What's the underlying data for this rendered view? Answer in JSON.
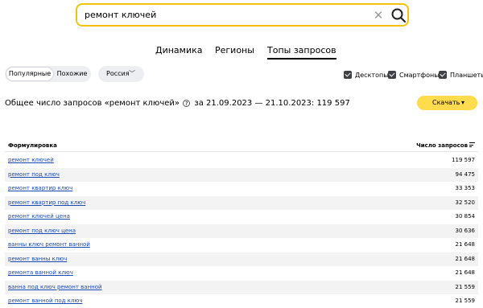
{
  "search": {
    "value": "ремонт ключей",
    "clear_icon": "close-icon",
    "submit_icon": "search-icon"
  },
  "tabs": [
    {
      "label": "Динамика",
      "active": false
    },
    {
      "label": "Регионы",
      "active": false
    },
    {
      "label": "Топы запросов",
      "active": true
    }
  ],
  "filters": {
    "mode_options": [
      {
        "label": "Популярные",
        "selected": true
      },
      {
        "label": "Похожие",
        "selected": false
      }
    ],
    "region": "Россия",
    "devices": [
      {
        "label": "Десктопы",
        "checked": true
      },
      {
        "label": "Смартфоны",
        "checked": true
      },
      {
        "label": "Планшеты",
        "checked": true
      }
    ]
  },
  "summary": {
    "prefix": "Общее число запросов «ремонт ключей»",
    "suffix": "за 21.09.2023 — 21.10.2023: 119 597"
  },
  "download_label": "Скачать",
  "table": {
    "col_phrase": "Формулировка",
    "col_count": "Число запросов",
    "rows": [
      {
        "phrase": "ремонт ключей",
        "count": "119 597"
      },
      {
        "phrase": "ремонт под ключ",
        "count": "94 475"
      },
      {
        "phrase": "ремонт квартир ключ",
        "count": "33 353"
      },
      {
        "phrase": "ремонт квартир под ключ",
        "count": "32 520"
      },
      {
        "phrase": "ремонт ключей цена",
        "count": "30 854"
      },
      {
        "phrase": "ремонт под ключ цена",
        "count": "30 636"
      },
      {
        "phrase": "ванны ключ ремонт ванной",
        "count": "21 648"
      },
      {
        "phrase": "ремонт ванны ключ",
        "count": "21 648"
      },
      {
        "phrase": "ремонта ванной ключ",
        "count": "21 648"
      },
      {
        "phrase": "ванна под ключ ремонт ванной",
        "count": "21 559"
      },
      {
        "phrase": "ремонт ванной под ключ",
        "count": "21 559"
      }
    ]
  },
  "colors": {
    "accent": "#ffdb4d",
    "search_border": "#f5c20b",
    "link": "#1a4bb5",
    "row_alt": "#f3f3f3"
  }
}
